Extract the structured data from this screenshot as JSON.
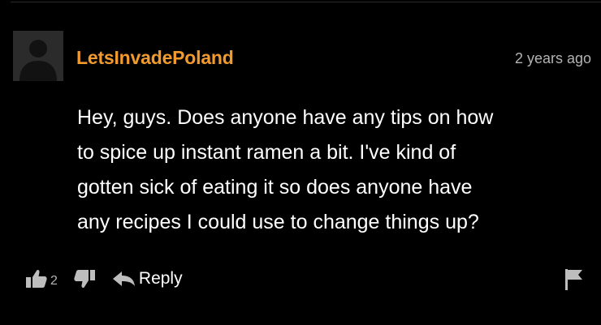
{
  "comment": {
    "username": "LetsInvadePoland",
    "timestamp": "2 years ago",
    "text_lines": [
      "Hey, guys. Does anyone have any tips on how",
      "to spice up instant ramen a bit. I've kind of",
      "gotten sick of eating it so does anyone have",
      "any recipes I could use to change things up?"
    ],
    "likes": "2",
    "reply_label": "Reply"
  },
  "colors": {
    "background": "#000000",
    "username": "#f29a2e",
    "text": "#ffffff",
    "muted": "#b3b3b3",
    "icon": "#bdbdbd"
  },
  "icons": {
    "avatar": "default-avatar-silhouette",
    "like": "thumbs-up-icon",
    "dislike": "thumbs-down-icon",
    "reply": "reply-arrow-icon",
    "flag": "flag-icon"
  }
}
